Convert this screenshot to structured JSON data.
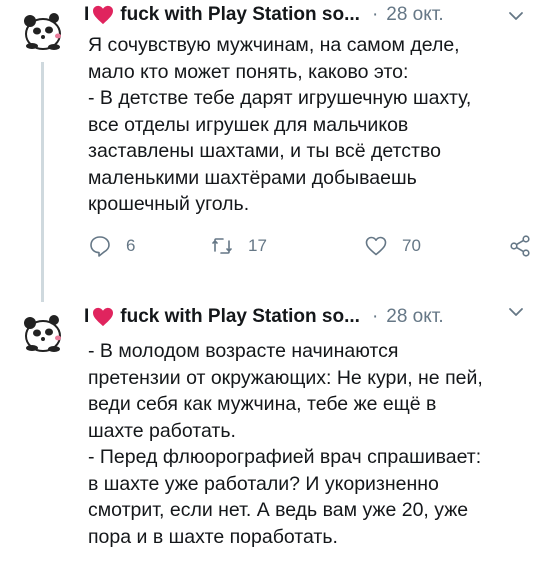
{
  "tweets": [
    {
      "name_prefix": "I",
      "name_suffix": "fuck with Play Station so...",
      "separator": "·",
      "date": "28 окт.",
      "lines": [
        "Я сочувствую мужчинам, на самом деле,",
        "мало кто может понять, каково это:",
        "- В детстве тебе дарят игрушечную шахту,",
        "все отделы игрушек для мальчиков",
        "заставлены шахтами, и ты всё детство",
        "маленькими шахтёрами добываешь",
        "крошечный уголь."
      ],
      "replies": "6",
      "retweets": "17",
      "likes": "70"
    },
    {
      "name_prefix": "I",
      "name_suffix": "fuck with Play Station so...",
      "separator": "·",
      "date": "28 окт.",
      "lines": [
        "- В молодом возрасте начинаются",
        "претензии от окружающих: Не кури, не пей,",
        "веди себя как мужчина, тебе же ещё в",
        "шахте работать.",
        "- Перед флюорографией врач спрашивает:",
        "в шахте уже работали? И укоризненно",
        "смотрит, если нет. А ведь вам уже 20, уже",
        "пора и в шахте поработать."
      ]
    }
  ],
  "icons": {
    "heart": "heart-icon",
    "avatar": "panda-avatar",
    "menu": "chevron-down-icon",
    "reply": "reply-icon",
    "retweet": "retweet-icon",
    "like": "like-icon",
    "share": "share-icon"
  },
  "colors": {
    "heart": "#e0245e",
    "muted": "#657786",
    "text": "#14171a",
    "thread": "#cfd9de"
  }
}
